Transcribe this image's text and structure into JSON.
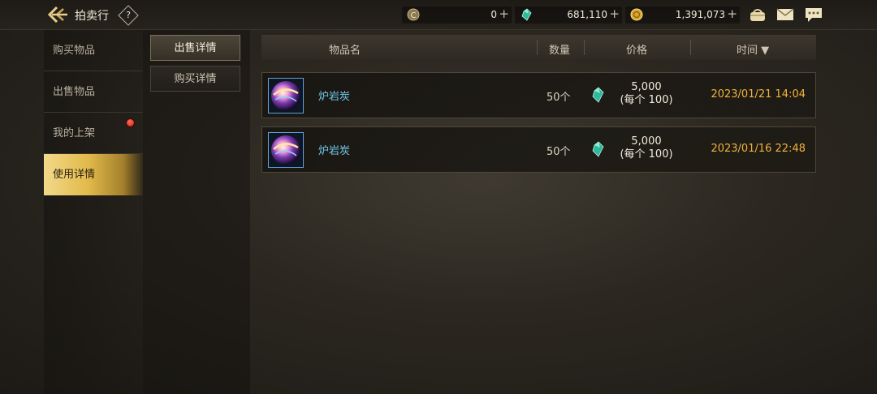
{
  "topbar": {
    "title": "拍卖行",
    "help_label": "?",
    "currencies": [
      {
        "icon": "coin-c-icon",
        "value": "0"
      },
      {
        "icon": "green-gem-icon",
        "value": "681,110"
      },
      {
        "icon": "gold-coin-icon",
        "value": "1,391,073"
      }
    ],
    "plus_label": "+"
  },
  "sidebar": {
    "items": [
      {
        "label": "购买物品"
      },
      {
        "label": "出售物品"
      },
      {
        "label": "我的上架"
      },
      {
        "label": "使用详情"
      }
    ]
  },
  "subtabs": [
    {
      "label": "出售详情"
    },
    {
      "label": "购买详情"
    }
  ],
  "table": {
    "headers": {
      "name": "物品名",
      "qty": "数量",
      "price": "价格",
      "time": "时间 ▼"
    },
    "rows": [
      {
        "name": "炉岩炭",
        "qty": "50个",
        "price": "5,000",
        "unit_price": "(每个 100)",
        "time": "2023/01/21 14:04"
      },
      {
        "name": "炉岩炭",
        "qty": "50个",
        "price": "5,000",
        "unit_price": "(每个 100)",
        "time": "2023/01/16 22:48"
      }
    ]
  },
  "colors": {
    "accent_gold": "#e2b94a",
    "time_text": "#f1b33a",
    "item_name": "#6fc8e8",
    "notification": "#d01810"
  }
}
